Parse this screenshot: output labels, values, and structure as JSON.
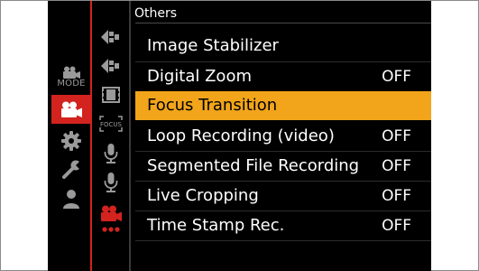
{
  "header": {
    "title": "Others"
  },
  "mode_tabs": [
    {
      "name": "creative-video-mode",
      "icon": "movie-camera-icon",
      "label": "MODE",
      "active": false
    },
    {
      "name": "video",
      "icon": "movie-camera-icon",
      "active": true
    },
    {
      "name": "custom",
      "icon": "gear-icon",
      "active": false
    },
    {
      "name": "setup",
      "icon": "wrench-icon",
      "active": false
    },
    {
      "name": "my-menu",
      "icon": "person-icon",
      "active": false
    }
  ],
  "sub_tabs": [
    {
      "name": "image-format",
      "icon": "arrow-mode-icon"
    },
    {
      "name": "image-quality",
      "icon": "arrow-mode-icon"
    },
    {
      "name": "film",
      "icon": "film-icon"
    },
    {
      "name": "focus",
      "icon": "focus-icon",
      "label": "FOCUS"
    },
    {
      "name": "audio-1",
      "icon": "microphone-icon"
    },
    {
      "name": "audio-2",
      "icon": "microphone-icon"
    },
    {
      "name": "others",
      "icon": "movie-camera-icon",
      "active": true
    }
  ],
  "menu": {
    "items": [
      {
        "label": "Image Stabilizer",
        "value": ""
      },
      {
        "label": "Digital Zoom",
        "value": "OFF"
      },
      {
        "label": "Focus Transition",
        "value": "",
        "selected": true
      },
      {
        "label": "Loop Recording (video)",
        "value": "OFF"
      },
      {
        "label": "Segmented File Recording",
        "value": "OFF"
      },
      {
        "label": "Live Cropping",
        "value": "OFF"
      },
      {
        "label": "Time Stamp Rec.",
        "value": "OFF"
      }
    ]
  },
  "colors": {
    "accent_red": "#d2231f",
    "selection": "#f2a51a",
    "background": "#000000"
  }
}
